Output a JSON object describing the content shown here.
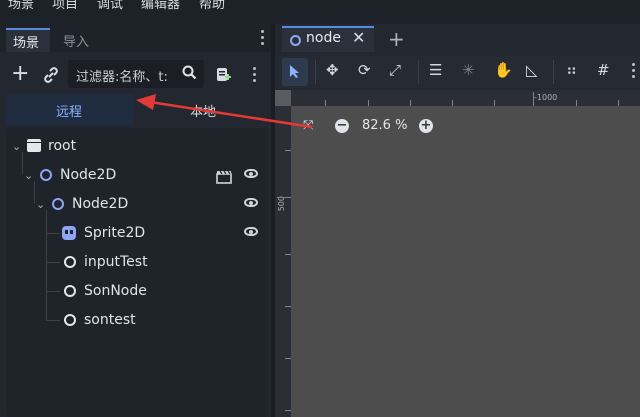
{
  "menubar": {
    "items": [
      "场景",
      "项目",
      "调试",
      "编辑器",
      "帮助"
    ]
  },
  "dock": {
    "tabs": [
      {
        "label": "场景"
      },
      {
        "label": "导入"
      }
    ],
    "filter_placeholder": "过滤器:名称、t:",
    "remote_label": "远程",
    "local_label": "本地"
  },
  "tree": {
    "nodes": [
      {
        "label": "root",
        "icon": "root-icon"
      },
      {
        "label": "Node2D",
        "icon": "node2d-icon"
      },
      {
        "label": "Node2D",
        "icon": "node2d-icon"
      },
      {
        "label": "Sprite2D",
        "icon": "sprite2d-icon"
      },
      {
        "label": "inputTest",
        "icon": "node-icon"
      },
      {
        "label": "SonNode",
        "icon": "node-icon"
      },
      {
        "label": "sontest",
        "icon": "node-icon"
      }
    ]
  },
  "editor": {
    "scene_tab": "node",
    "zoom": "82.6 %",
    "ruler_top_label": "-1000",
    "ruler_left_label": "500"
  },
  "colors": {
    "accent": "#5b8be0",
    "node2d": "#8da5f3",
    "arrow": "#e53935"
  }
}
